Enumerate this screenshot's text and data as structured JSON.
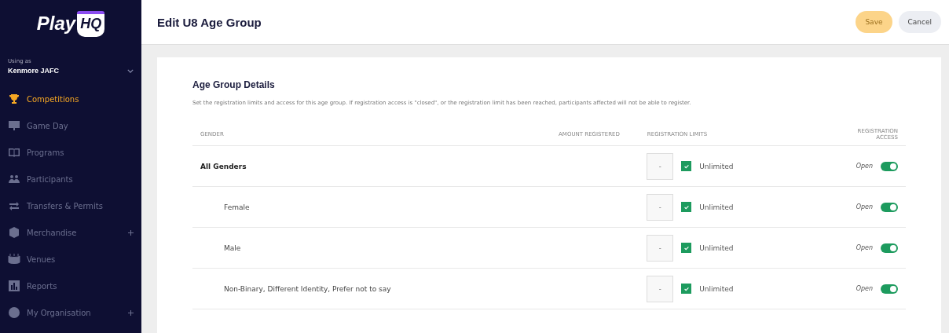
{
  "sidebar": {
    "logo": {
      "text": "Play",
      "badge": "HQ"
    },
    "using_as_label": "Using as",
    "organisation": "Kenmore JAFC",
    "items": [
      {
        "label": "Competitions",
        "selected": true,
        "expandable": false
      },
      {
        "label": "Game Day",
        "selected": false,
        "expandable": false
      },
      {
        "label": "Programs",
        "selected": false,
        "expandable": false
      },
      {
        "label": "Participants",
        "selected": false,
        "expandable": false
      },
      {
        "label": "Transfers & Permits",
        "selected": false,
        "expandable": false
      },
      {
        "label": "Merchandise",
        "selected": false,
        "expandable": true
      },
      {
        "label": "Venues",
        "selected": false,
        "expandable": false
      },
      {
        "label": "Reports",
        "selected": false,
        "expandable": false
      },
      {
        "label": "My Organisation",
        "selected": false,
        "expandable": true
      }
    ]
  },
  "header": {
    "title": "Edit U8 Age Group",
    "buttons": [
      {
        "label": "Save",
        "kind": "primary",
        "disabled": true
      },
      {
        "label": "Cancel",
        "kind": "secondary",
        "disabled": false
      }
    ]
  },
  "section": {
    "title": "Age Group Details",
    "description": "Set the registration limits and access for this age group. If registration access is \"closed\", or the registration limit has been reached, participants affected will not be able to register.",
    "table": {
      "columns": [
        "GENDER",
        "AMOUNT REGISTERED",
        "REGISTRATION LIMITS",
        "REGISTRATION ACCESS"
      ],
      "rows": [
        {
          "gender": "All Genders",
          "limit_placeholder": "-",
          "unlimited": {
            "label": "Unlimited",
            "checked": true
          },
          "access": {
            "label": "Open",
            "on": true
          },
          "children": [
            {
              "gender": "Female",
              "limit_placeholder": "-",
              "unlimited": {
                "label": "Unlimited",
                "checked": true
              },
              "access": {
                "label": "Open",
                "on": true
              }
            },
            {
              "gender": "Male",
              "limit_placeholder": "-",
              "unlimited": {
                "label": "Unlimited",
                "checked": true
              },
              "access": {
                "label": "Open",
                "on": true
              }
            },
            {
              "gender": "Non-Binary, Different Identity, Prefer not to say",
              "limit_placeholder": "-",
              "unlimited": {
                "label": "Unlimited",
                "checked": true
              },
              "access": {
                "label": "Open",
                "on": true
              }
            }
          ]
        }
      ]
    }
  }
}
